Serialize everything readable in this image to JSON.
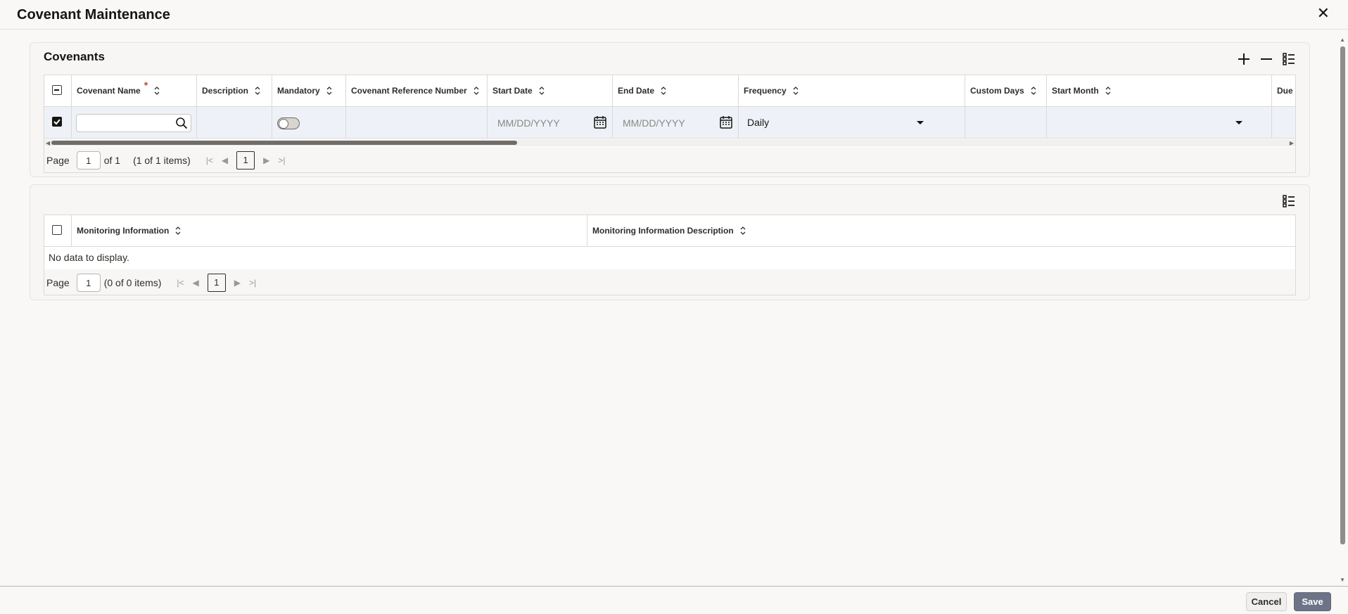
{
  "window": {
    "title": "Covenant Maintenance",
    "close_label": "✕"
  },
  "covenants": {
    "title": "Covenants",
    "toolbar": {
      "add": "add",
      "remove": "remove",
      "columns": "columns"
    },
    "columns": [
      "Covenant Name",
      "Description",
      "Mandatory",
      "Covenant Reference Number",
      "Start Date",
      "End Date",
      "Frequency",
      "Custom Days",
      "Start Month",
      "Due"
    ],
    "row": {
      "covenant_name": "",
      "start_date_placeholder": "MM/DD/YYYY",
      "end_date_placeholder": "MM/DD/YYYY",
      "frequency": "Daily",
      "start_month": "",
      "mandatory": false,
      "selected": true
    },
    "pager": {
      "label": "Page",
      "page": "1",
      "of": "of 1",
      "items": "(1 of 1 items)",
      "current": "1"
    }
  },
  "monitoring": {
    "columns": [
      "Monitoring Information",
      "Monitoring Information Description"
    ],
    "empty_text": "No data to display.",
    "pager": {
      "label": "Page",
      "page": "1",
      "items": "(0 of 0 items)",
      "current": "1"
    }
  },
  "footer": {
    "cancel": "Cancel",
    "save": "Save"
  },
  "colors": {
    "accent": "#6d7487",
    "selected_row": "#eef2f8"
  }
}
